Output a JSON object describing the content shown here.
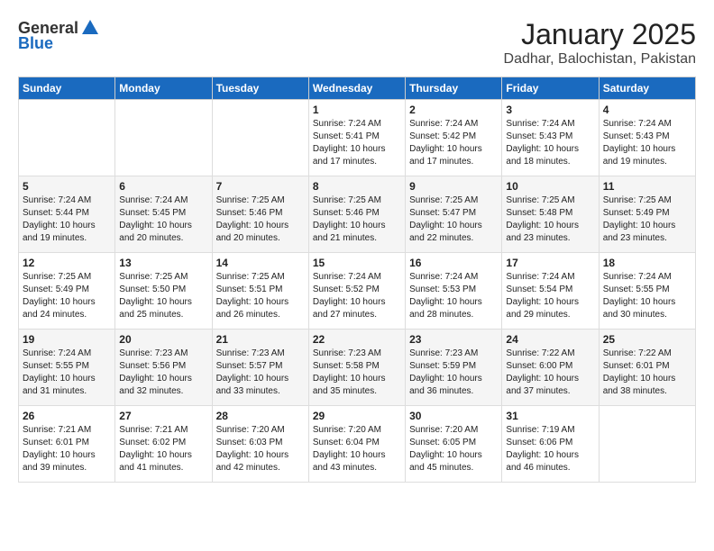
{
  "header": {
    "logo_line1": "General",
    "logo_line2": "Blue",
    "title": "January 2025",
    "subtitle": "Dadhar, Balochistan, Pakistan"
  },
  "weekdays": [
    "Sunday",
    "Monday",
    "Tuesday",
    "Wednesday",
    "Thursday",
    "Friday",
    "Saturday"
  ],
  "weeks": [
    [
      {
        "day": "",
        "info": ""
      },
      {
        "day": "",
        "info": ""
      },
      {
        "day": "",
        "info": ""
      },
      {
        "day": "1",
        "info": "Sunrise: 7:24 AM\nSunset: 5:41 PM\nDaylight: 10 hours\nand 17 minutes."
      },
      {
        "day": "2",
        "info": "Sunrise: 7:24 AM\nSunset: 5:42 PM\nDaylight: 10 hours\nand 17 minutes."
      },
      {
        "day": "3",
        "info": "Sunrise: 7:24 AM\nSunset: 5:43 PM\nDaylight: 10 hours\nand 18 minutes."
      },
      {
        "day": "4",
        "info": "Sunrise: 7:24 AM\nSunset: 5:43 PM\nDaylight: 10 hours\nand 19 minutes."
      }
    ],
    [
      {
        "day": "5",
        "info": "Sunrise: 7:24 AM\nSunset: 5:44 PM\nDaylight: 10 hours\nand 19 minutes."
      },
      {
        "day": "6",
        "info": "Sunrise: 7:24 AM\nSunset: 5:45 PM\nDaylight: 10 hours\nand 20 minutes."
      },
      {
        "day": "7",
        "info": "Sunrise: 7:25 AM\nSunset: 5:46 PM\nDaylight: 10 hours\nand 20 minutes."
      },
      {
        "day": "8",
        "info": "Sunrise: 7:25 AM\nSunset: 5:46 PM\nDaylight: 10 hours\nand 21 minutes."
      },
      {
        "day": "9",
        "info": "Sunrise: 7:25 AM\nSunset: 5:47 PM\nDaylight: 10 hours\nand 22 minutes."
      },
      {
        "day": "10",
        "info": "Sunrise: 7:25 AM\nSunset: 5:48 PM\nDaylight: 10 hours\nand 23 minutes."
      },
      {
        "day": "11",
        "info": "Sunrise: 7:25 AM\nSunset: 5:49 PM\nDaylight: 10 hours\nand 23 minutes."
      }
    ],
    [
      {
        "day": "12",
        "info": "Sunrise: 7:25 AM\nSunset: 5:49 PM\nDaylight: 10 hours\nand 24 minutes."
      },
      {
        "day": "13",
        "info": "Sunrise: 7:25 AM\nSunset: 5:50 PM\nDaylight: 10 hours\nand 25 minutes."
      },
      {
        "day": "14",
        "info": "Sunrise: 7:25 AM\nSunset: 5:51 PM\nDaylight: 10 hours\nand 26 minutes."
      },
      {
        "day": "15",
        "info": "Sunrise: 7:24 AM\nSunset: 5:52 PM\nDaylight: 10 hours\nand 27 minutes."
      },
      {
        "day": "16",
        "info": "Sunrise: 7:24 AM\nSunset: 5:53 PM\nDaylight: 10 hours\nand 28 minutes."
      },
      {
        "day": "17",
        "info": "Sunrise: 7:24 AM\nSunset: 5:54 PM\nDaylight: 10 hours\nand 29 minutes."
      },
      {
        "day": "18",
        "info": "Sunrise: 7:24 AM\nSunset: 5:55 PM\nDaylight: 10 hours\nand 30 minutes."
      }
    ],
    [
      {
        "day": "19",
        "info": "Sunrise: 7:24 AM\nSunset: 5:55 PM\nDaylight: 10 hours\nand 31 minutes."
      },
      {
        "day": "20",
        "info": "Sunrise: 7:23 AM\nSunset: 5:56 PM\nDaylight: 10 hours\nand 32 minutes."
      },
      {
        "day": "21",
        "info": "Sunrise: 7:23 AM\nSunset: 5:57 PM\nDaylight: 10 hours\nand 33 minutes."
      },
      {
        "day": "22",
        "info": "Sunrise: 7:23 AM\nSunset: 5:58 PM\nDaylight: 10 hours\nand 35 minutes."
      },
      {
        "day": "23",
        "info": "Sunrise: 7:23 AM\nSunset: 5:59 PM\nDaylight: 10 hours\nand 36 minutes."
      },
      {
        "day": "24",
        "info": "Sunrise: 7:22 AM\nSunset: 6:00 PM\nDaylight: 10 hours\nand 37 minutes."
      },
      {
        "day": "25",
        "info": "Sunrise: 7:22 AM\nSunset: 6:01 PM\nDaylight: 10 hours\nand 38 minutes."
      }
    ],
    [
      {
        "day": "26",
        "info": "Sunrise: 7:21 AM\nSunset: 6:01 PM\nDaylight: 10 hours\nand 39 minutes."
      },
      {
        "day": "27",
        "info": "Sunrise: 7:21 AM\nSunset: 6:02 PM\nDaylight: 10 hours\nand 41 minutes."
      },
      {
        "day": "28",
        "info": "Sunrise: 7:20 AM\nSunset: 6:03 PM\nDaylight: 10 hours\nand 42 minutes."
      },
      {
        "day": "29",
        "info": "Sunrise: 7:20 AM\nSunset: 6:04 PM\nDaylight: 10 hours\nand 43 minutes."
      },
      {
        "day": "30",
        "info": "Sunrise: 7:20 AM\nSunset: 6:05 PM\nDaylight: 10 hours\nand 45 minutes."
      },
      {
        "day": "31",
        "info": "Sunrise: 7:19 AM\nSunset: 6:06 PM\nDaylight: 10 hours\nand 46 minutes."
      },
      {
        "day": "",
        "info": ""
      }
    ]
  ]
}
